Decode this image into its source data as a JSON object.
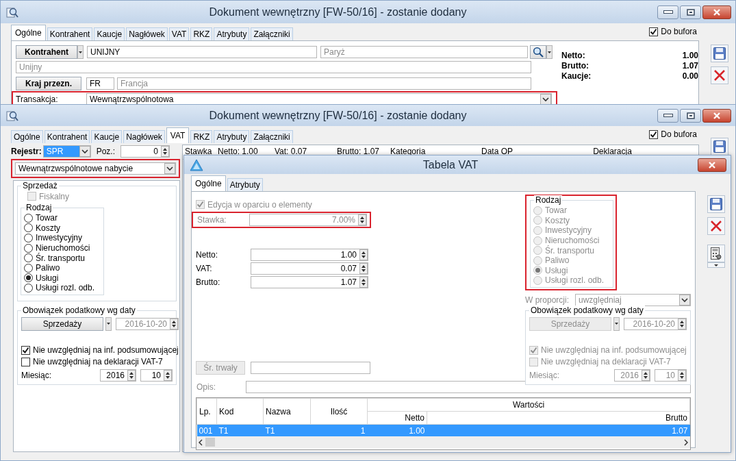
{
  "main_window": {
    "title": "Dokument wewnętrzny [FW-50/16]  - zostanie dodany",
    "tabs": [
      {
        "label": "Ogólne",
        "selected": true
      },
      {
        "label": "Kontrahent",
        "selected": false
      },
      {
        "label": "Kaucje",
        "selected": false
      },
      {
        "label": "Nagłówek",
        "selected": false
      },
      {
        "label": "VAT",
        "selected": false
      },
      {
        "label": "RKZ",
        "selected": false
      },
      {
        "label": "Atrybuty",
        "selected": false
      },
      {
        "label": "Załączniki",
        "selected": false
      }
    ],
    "do_bufora": {
      "label": "Do bufora",
      "checked": true
    },
    "kontrahent": {
      "button": "Kontrahent",
      "code": "UNIJNY",
      "city": "Paryż",
      "name": "Unijny"
    },
    "kraj": {
      "button": "Kraj przezn.",
      "code": "FR",
      "name": "Francja"
    },
    "transakcja": {
      "label": "Transakcja:",
      "value": "Wewnątrzwspólnotowa",
      "highlighted": true
    },
    "totals": [
      {
        "label": "Netto:",
        "value": "1.00"
      },
      {
        "label": "Brutto:",
        "value": "1.07"
      },
      {
        "label": "Kaucje:",
        "value": "0.00"
      }
    ]
  },
  "vat_window": {
    "title": "Dokument wewnętrzny [FW-50/16]  - zostanie dodany",
    "tabs": [
      {
        "label": "Ogólne",
        "selected": false
      },
      {
        "label": "Kontrahent",
        "selected": false
      },
      {
        "label": "Kaucje",
        "selected": false
      },
      {
        "label": "Nagłówek",
        "selected": false
      },
      {
        "label": "VAT",
        "selected": true
      },
      {
        "label": "RKZ",
        "selected": false
      },
      {
        "label": "Atrybuty",
        "selected": false
      },
      {
        "label": "Załączniki",
        "selected": false
      }
    ],
    "do_bufora": {
      "label": "Do bufora",
      "checked": true
    },
    "rejestr": {
      "label": "Rejestr:",
      "value": "SPR"
    },
    "poz": {
      "label": "Poz.:",
      "value": "0"
    },
    "grid_columns": [
      "Stawka",
      "Netto: 1.00",
      "Vat: 0.07",
      "Brutto: 1.07",
      "Kategoria",
      "Data OP",
      "Deklaracja"
    ],
    "rodzaj_transakcji": {
      "value": "Wewnątrzwspólnotowe nabycie",
      "highlighted": true
    },
    "sprzedaz": {
      "title": "Sprzedaż",
      "fiskalny": {
        "label": "Fiskalny",
        "checked": false,
        "disabled": true
      },
      "rodzaj": {
        "title": "Rodzaj",
        "disabled": false,
        "options": [
          {
            "label": "Towar",
            "selected": false
          },
          {
            "label": "Koszty",
            "selected": false
          },
          {
            "label": "Inwestycyjny",
            "selected": false
          },
          {
            "label": "Nieruchomości",
            "selected": false
          },
          {
            "label": "Śr. transportu",
            "selected": false
          },
          {
            "label": "Paliwo",
            "selected": false
          },
          {
            "label": "Usługi",
            "selected": true
          },
          {
            "label": "Usługi rozl. odb.",
            "selected": false
          }
        ]
      }
    },
    "obowiazek": {
      "title": "Obowiązek podatkowy wg daty",
      "disabled": false,
      "button": "Sprzedaży",
      "date": {
        "value": "2016-10-20",
        "disabled": true
      },
      "checks": [
        {
          "label": "Nie uwzględniaj na inf. podsumowującej",
          "checked": true
        },
        {
          "label": "Nie uwzględniaj na deklaracji VAT-7",
          "checked": false
        }
      ],
      "miesiac": {
        "label": "Miesiąc:",
        "year": "2016",
        "month": "10"
      }
    }
  },
  "vat_dialog": {
    "title": "Tabela VAT",
    "tabs": [
      {
        "label": "Ogólne",
        "selected": true
      },
      {
        "label": "Atrybuty",
        "selected": false
      }
    ],
    "edycja": {
      "label": "Edycja w oparciu o elementy",
      "checked": true,
      "disabled": true
    },
    "stawka": {
      "label": "Stawka:",
      "value": "7.00%",
      "disabled": true,
      "highlighted": true
    },
    "amounts": [
      {
        "label": "Netto:",
        "value": "1.00"
      },
      {
        "label": "VAT:",
        "value": "0.07"
      },
      {
        "label": "Brutto:",
        "value": "1.07"
      }
    ],
    "rodzaj": {
      "title": "Rodzaj",
      "disabled": true,
      "highlighted": true,
      "options": [
        {
          "label": "Towar",
          "selected": false
        },
        {
          "label": "Koszty",
          "selected": false
        },
        {
          "label": "Inwestycyjny",
          "selected": false
        },
        {
          "label": "Nieruchomości",
          "selected": false
        },
        {
          "label": "Śr. transportu",
          "selected": false
        },
        {
          "label": "Paliwo",
          "selected": false
        },
        {
          "label": "Usługi",
          "selected": true
        },
        {
          "label": "Usługi rozl. odb.",
          "selected": false
        }
      ]
    },
    "w_proporcji": {
      "label": "W proporcji:",
      "value": "uwzględniaj",
      "disabled": true
    },
    "obowiazek": {
      "title": "Obowiązek podatkowy wg daty",
      "disabled": true,
      "button": "Sprzedaży",
      "date": {
        "value": "2016-10-20",
        "disabled": true
      },
      "checks": [
        {
          "label": "Nie uwzględniaj na inf. podsumowującej",
          "checked": true
        },
        {
          "label": "Nie uwzględniaj na deklaracji VAT-7",
          "checked": false
        }
      ],
      "miesiac": {
        "label": "Miesiąc:",
        "year": "2016",
        "month": "10"
      }
    },
    "sr_trwaly": {
      "button": "Śr. trwały",
      "disabled": true
    },
    "opis": {
      "label": "Opis:"
    },
    "table": {
      "group_header": "Wartości",
      "columns": [
        "Lp.",
        "Kod",
        "Nazwa",
        "Ilość",
        "Netto",
        "Brutto"
      ],
      "rows": [
        {
          "cells": [
            "001",
            "T1",
            "T1",
            "1",
            "1.00",
            "1.07"
          ],
          "selected": true
        }
      ]
    }
  }
}
